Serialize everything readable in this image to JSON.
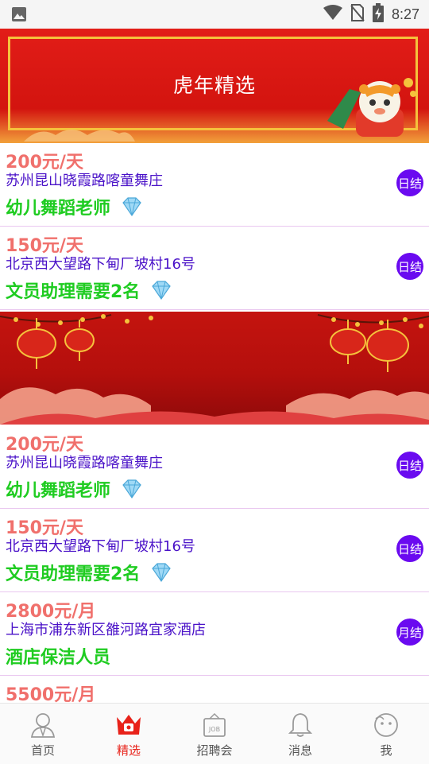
{
  "status_bar": {
    "time": "8:27",
    "icons": [
      "image-icon",
      "wifi-icon",
      "no-sim-icon",
      "battery-charging-icon"
    ]
  },
  "hero_banner": {
    "title": "虎年精选",
    "decoration": "tiger-mascot-icon"
  },
  "jobs_top": [
    {
      "salary": "200元/天",
      "address": "苏州昆山晓霞路喀童舞庄",
      "title": "幼儿舞蹈老师",
      "diamond": true,
      "badge": "日结"
    },
    {
      "salary": "150元/天",
      "address": "北京西大望路下甸厂坡村16号",
      "title": "文员助理需要2名",
      "diamond": true,
      "badge": "日结"
    }
  ],
  "jobs_bottom": [
    {
      "salary": "200元/天",
      "address": "苏州昆山晓霞路喀童舞庄",
      "title": "幼儿舞蹈老师",
      "diamond": true,
      "badge": "日结"
    },
    {
      "salary": "150元/天",
      "address": "北京西大望路下甸厂坡村16号",
      "title": "文员助理需要2名",
      "diamond": true,
      "badge": "日结"
    },
    {
      "salary": "2800元/月",
      "address": "上海市浦东新区雒河路宜家酒店",
      "title": "酒店保洁人员",
      "diamond": false,
      "badge": "月结"
    },
    {
      "salary": "5500元/月"
    }
  ],
  "bottom_nav": {
    "items": [
      {
        "label": "首页",
        "icon": "person-icon",
        "active": false
      },
      {
        "label": "精选",
        "icon": "crown-icon",
        "active": true
      },
      {
        "label": "招聘会",
        "icon": "job-board-icon",
        "active": false
      },
      {
        "label": "消息",
        "icon": "bell-icon",
        "active": false
      },
      {
        "label": "我",
        "icon": "smiley-face-icon",
        "active": false
      }
    ]
  },
  "colors": {
    "salary": "#f0706c",
    "address": "#4a12c8",
    "job_title": "#1fcc21",
    "badge": "#6a0af0",
    "nav_active": "#e8221a",
    "banner_red": "#e21d18"
  }
}
